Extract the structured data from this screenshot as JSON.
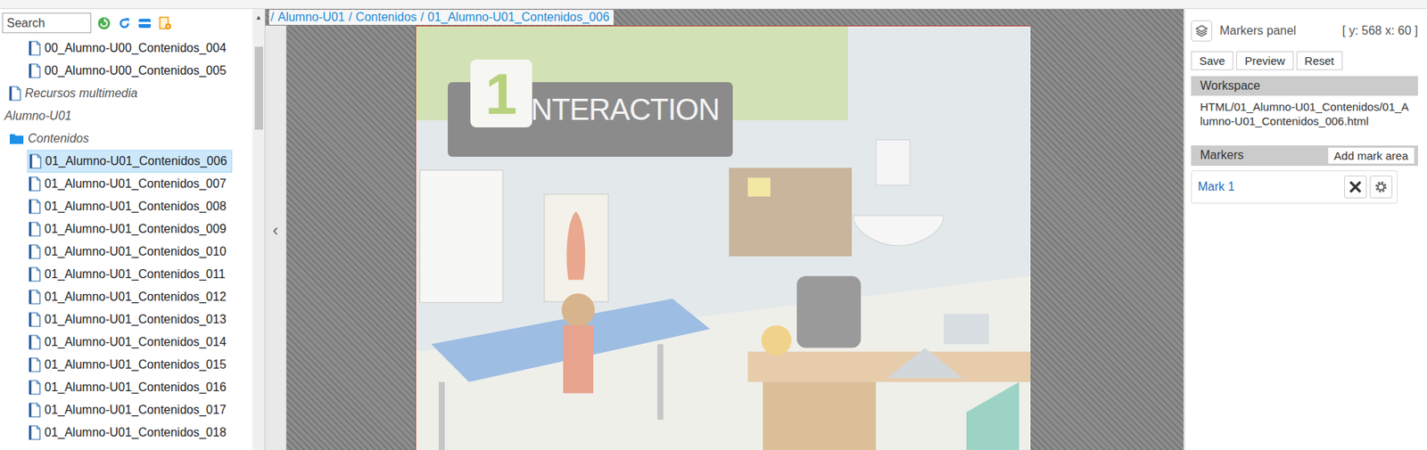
{
  "search": {
    "placeholder": "Search"
  },
  "tree": [
    {
      "label": "00_Alumno-U00_Contenidos_004",
      "kind": "file",
      "selected": false
    },
    {
      "label": "00_Alumno-U00_Contenidos_005",
      "kind": "file",
      "selected": false
    },
    {
      "label": "Recursos multimedia",
      "kind": "resource",
      "selected": false
    },
    {
      "label": "Alumno-U01",
      "kind": "group",
      "selected": false
    },
    {
      "label": "Contenidos",
      "kind": "folder",
      "selected": false
    },
    {
      "label": "01_Alumno-U01_Contenidos_006",
      "kind": "file",
      "selected": true
    },
    {
      "label": "01_Alumno-U01_Contenidos_007",
      "kind": "file",
      "selected": false
    },
    {
      "label": "01_Alumno-U01_Contenidos_008",
      "kind": "file",
      "selected": false
    },
    {
      "label": "01_Alumno-U01_Contenidos_009",
      "kind": "file",
      "selected": false
    },
    {
      "label": "01_Alumno-U01_Contenidos_010",
      "kind": "file",
      "selected": false
    },
    {
      "label": "01_Alumno-U01_Contenidos_011",
      "kind": "file",
      "selected": false
    },
    {
      "label": "01_Alumno-U01_Contenidos_012",
      "kind": "file",
      "selected": false
    },
    {
      "label": "01_Alumno-U01_Contenidos_013",
      "kind": "file",
      "selected": false
    },
    {
      "label": "01_Alumno-U01_Contenidos_014",
      "kind": "file",
      "selected": false
    },
    {
      "label": "01_Alumno-U01_Contenidos_015",
      "kind": "file",
      "selected": false
    },
    {
      "label": "01_Alumno-U01_Contenidos_016",
      "kind": "file",
      "selected": false
    },
    {
      "label": "01_Alumno-U01_Contenidos_017",
      "kind": "file",
      "selected": false
    },
    {
      "label": "01_Alumno-U01_Contenidos_018",
      "kind": "file",
      "selected": false
    }
  ],
  "scroll_up": "▲",
  "collapse": "‹",
  "breadcrumb": {
    "separator": "/",
    "items": [
      "Alumno-U01",
      "Contenidos",
      "01_Alumno-U01_Contenidos_006"
    ]
  },
  "page": {
    "number": "1",
    "title": "INTERACTION"
  },
  "markers_panel": {
    "title": "Markers panel",
    "coords": "[ y: 568 x: 60 ]",
    "buttons": [
      "Save",
      "Preview",
      "Reset"
    ],
    "workspace": {
      "title": "Workspace",
      "path": "HTML/01_Alumno-U01_Contenidos/01_Alumno-U01_Contenidos_006.html"
    },
    "markers": {
      "title": "Markers",
      "add_button": "Add mark area",
      "items": [
        {
          "label": "Mark 1"
        }
      ]
    }
  }
}
